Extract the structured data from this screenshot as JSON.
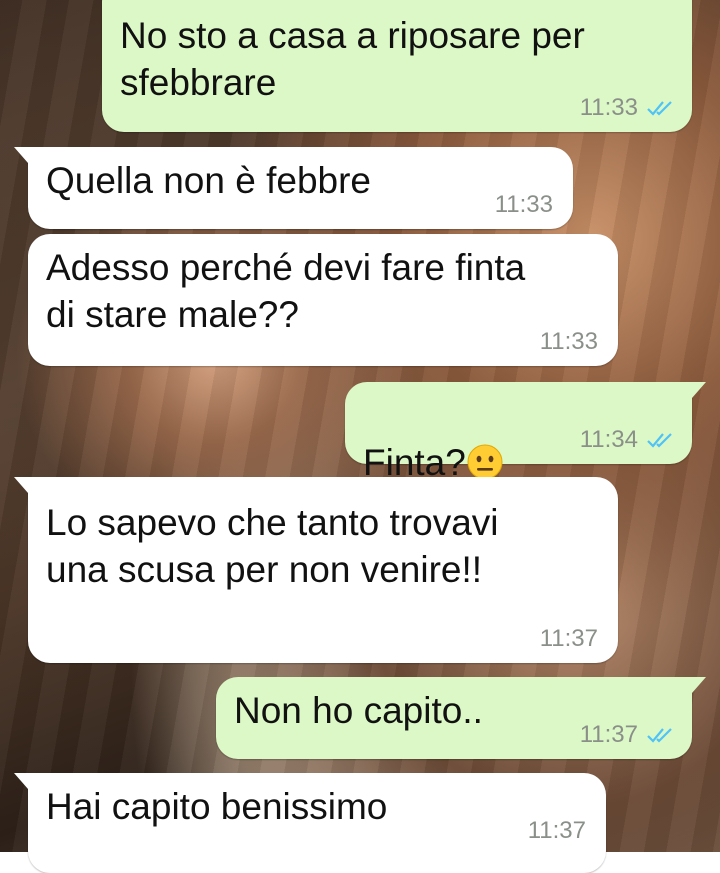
{
  "messages": [
    {
      "dir": "out",
      "text": "No sto a casa a riposare per\nsfebbrare",
      "time": "11:33",
      "status": "read"
    },
    {
      "dir": "in",
      "text": "Quella non è febbre",
      "time": "11:33"
    },
    {
      "dir": "in",
      "text": "Adesso perché devi fare finta\ndi stare male??",
      "time": "11:33"
    },
    {
      "dir": "out",
      "text": "Finta?",
      "emoji": "neutral-face",
      "time": "11:34",
      "status": "read"
    },
    {
      "dir": "in",
      "text": "Lo sapevo che tanto trovavi\nuna scusa per non venire!!",
      "time": "11:37"
    },
    {
      "dir": "out",
      "text": "Non ho capito..",
      "time": "11:37",
      "status": "read"
    },
    {
      "dir": "in",
      "text": "Hai capito benissimo",
      "time": "11:37"
    }
  ],
  "colors": {
    "incoming_bubble": "#ffffff",
    "outgoing_bubble": "#dcf8c6",
    "read_ticks": "#4fc3f7",
    "timestamp": "#8a9089"
  },
  "icons": {
    "read_receipt": "double-check-icon",
    "emoji": "neutral-face-emoji"
  }
}
